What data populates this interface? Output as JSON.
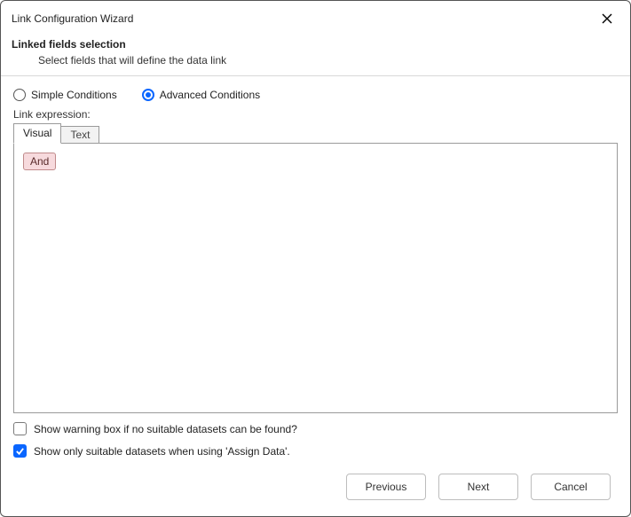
{
  "window": {
    "title": "Link Configuration Wizard"
  },
  "header": {
    "heading": "Linked fields selection",
    "subtitle": "Select fields that will define the data link"
  },
  "conditions": {
    "simple_label": "Simple Conditions",
    "advanced_label": "Advanced Conditions",
    "selected": "advanced"
  },
  "expression": {
    "label": "Link expression:",
    "tabs": {
      "visual": "Visual",
      "text": "Text",
      "active": "visual"
    },
    "root_operator": "And"
  },
  "options": {
    "warning_label": "Show warning box if no suitable datasets can be found?",
    "warning_checked": false,
    "suitable_label": "Show only suitable datasets when using 'Assign Data'.",
    "suitable_checked": true
  },
  "footer": {
    "previous": "Previous",
    "next": "Next",
    "cancel": "Cancel"
  }
}
